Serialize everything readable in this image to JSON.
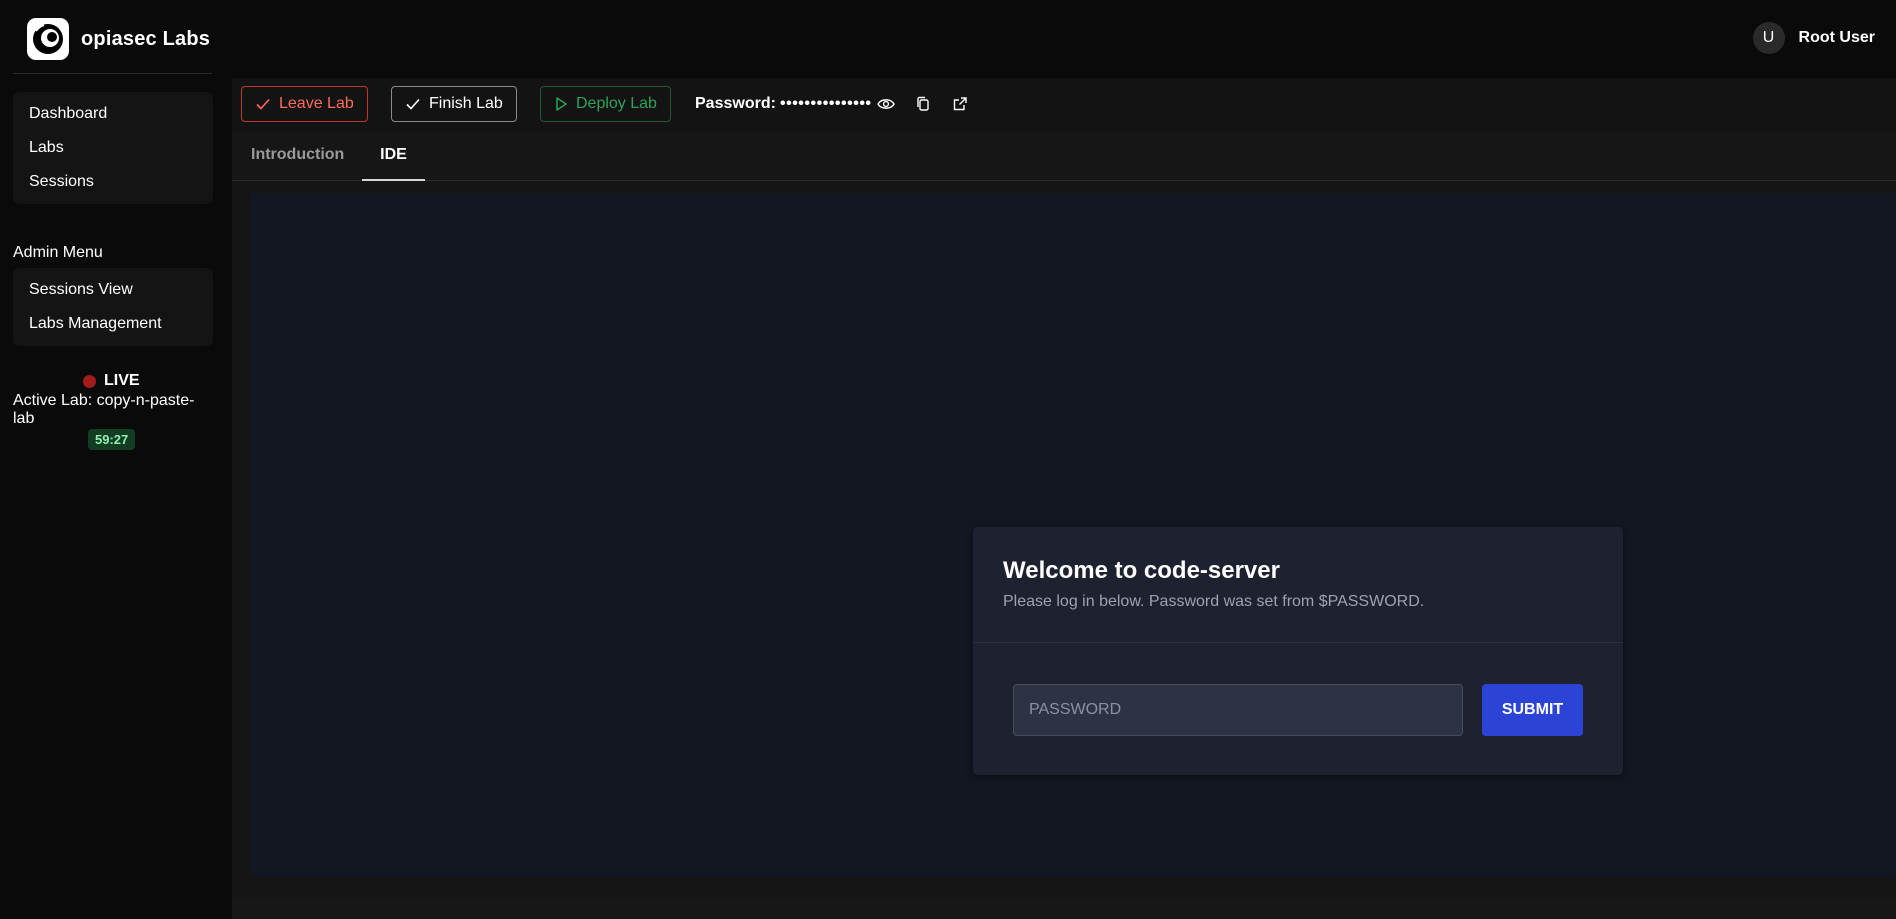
{
  "brand": {
    "name": "opiasec Labs",
    "logo_icon": "opiasec-logo-icon"
  },
  "user": {
    "initial": "U",
    "name": "Root User"
  },
  "sidebar": {
    "main_items": [
      {
        "label": "Dashboard"
      },
      {
        "label": "Labs"
      },
      {
        "label": "Sessions"
      }
    ],
    "admin_title": "Admin Menu",
    "admin_items": [
      {
        "label": "Sessions View"
      },
      {
        "label": "Labs Management"
      }
    ],
    "live_label": "LIVE",
    "active_lab": "Active Lab: copy-n-paste-lab",
    "timer": "59:27"
  },
  "toolbar": {
    "leave_label": "Leave Lab",
    "finish_label": "Finish Lab",
    "deploy_label": "Deploy Lab",
    "password_label": "Password:",
    "password_mask": "•••••••••••••••"
  },
  "tabs": [
    {
      "label": "Introduction",
      "active": false
    },
    {
      "label": "IDE",
      "active": true
    }
  ],
  "login": {
    "title": "Welcome to code-server",
    "subtitle": "Please log in below. Password was set from $PASSWORD.",
    "placeholder": "PASSWORD",
    "submit_label": "SUBMIT"
  },
  "colors": {
    "leave": "#ff6b5a",
    "deploy": "#2ea25a",
    "submit": "#2b44d6",
    "live_dot": "#a31b1b",
    "timer_bg": "#123d22"
  }
}
